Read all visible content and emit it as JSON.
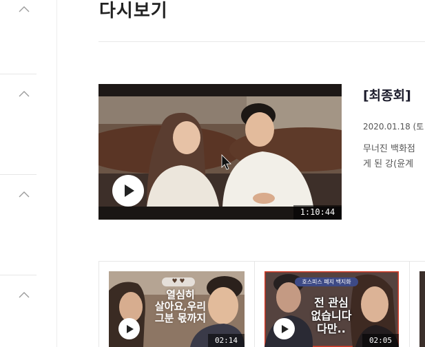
{
  "sidebar": {
    "sections": [
      {
        "icon": "chevron-up-icon"
      },
      {
        "icon": "chevron-up-icon"
      },
      {
        "icon": "chevron-up-icon"
      },
      {
        "icon": "chevron-up-icon"
      }
    ]
  },
  "page": {
    "title": "다시보기"
  },
  "featured": {
    "title": "[최종회]",
    "date": "2020.01.18 (토",
    "description_line1": "무너진 백화점",
    "description_line2": "게 된 강(윤계",
    "duration": "1:10:44"
  },
  "clips": [
    {
      "duration": "02:14",
      "badge": "♥ ♥",
      "caption_lines": [
        "열심히",
        "살아요,우리",
        "그분 몫까지"
      ]
    },
    {
      "duration": "02:05",
      "badge": "호스피스 폐지 백지화",
      "caption_lines": [
        "전 관심",
        "없습니다",
        "다만.."
      ]
    },
    {
      "duration": ""
    }
  ],
  "colors": {
    "title": "#222222",
    "episode_title": "#1c1c2c",
    "text_muted": "#555555",
    "divider": "#e6e6e6",
    "play_button": "#ffffff"
  }
}
